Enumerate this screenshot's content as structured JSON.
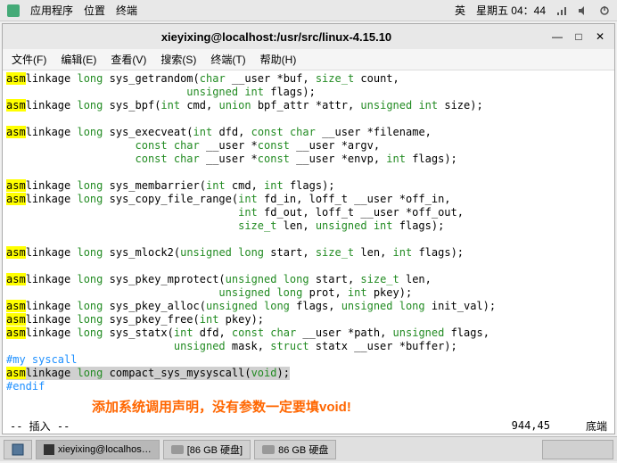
{
  "panel": {
    "apps": "应用程序",
    "places": "位置",
    "terminal": "终端",
    "lang": "英",
    "date": "星期五 04：44"
  },
  "window": {
    "title": "xieyixing@localhost:/usr/src/linux-4.15.10"
  },
  "menu": {
    "file": "文件(F)",
    "edit": "编辑(E)",
    "view": "查看(V)",
    "search": "搜索(S)",
    "terminal": "终端(T)",
    "help": "帮助(H)"
  },
  "status": {
    "mode": "-- 插入 --",
    "pos": "944,45",
    "pct": "底端"
  },
  "annotation": "添加系统调用声明，没有参数一定要填void!",
  "comment_my": "#my syscall",
  "comment_endif": "#endif",
  "taskbar": {
    "item1": "xieyixing@localhos…",
    "item2": "[86 GB 硬盘]",
    "item3": "86 GB 硬盘"
  },
  "chart_data": null
}
